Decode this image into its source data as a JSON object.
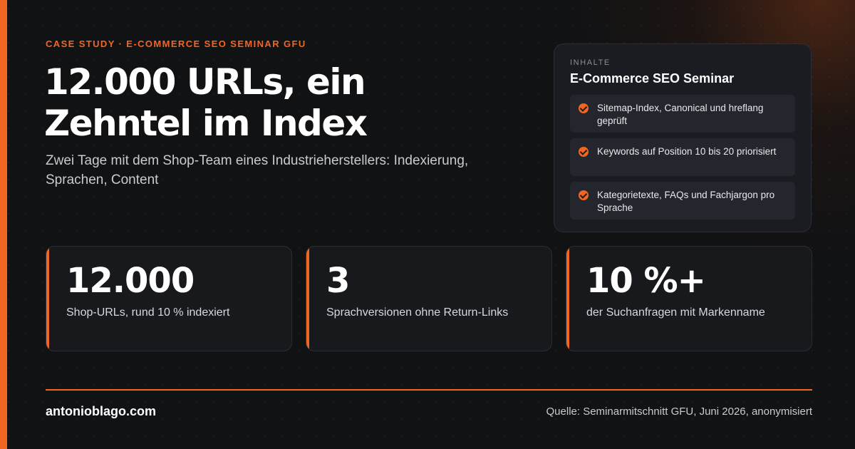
{
  "eyebrow": "CASE STUDY · E-COMMERCE SEO SEMINAR GFU",
  "headline": "12.000 URLs, ein Zehntel im Index",
  "subline": "Zwei Tage mit dem Shop-Team eines Industrieherstellers: Indexierung, Sprachen, Content",
  "content_card": {
    "kicker": "INHALTE",
    "title": "E-Commerce SEO Seminar",
    "items": [
      {
        "icon": "check-circle-icon",
        "text": "Sitemap-Index, Canonical und hreflang geprüft"
      },
      {
        "icon": "check-circle-icon",
        "text": "Keywords auf Position 10 bis 20 priorisiert"
      },
      {
        "icon": "check-circle-icon",
        "text": "Kategorietexte, FAQs und Fachjargon pro Sprache"
      }
    ]
  },
  "stats": [
    {
      "value": "12.000",
      "label": "Shop-URLs, rund 10 % indexiert"
    },
    {
      "value": "3",
      "label": "Sprachversionen ohne Return-Links"
    },
    {
      "value": "10 %+",
      "label": "der Suchanfragen mit Markenname"
    }
  ],
  "footer": {
    "domain": "antonioblago.com",
    "source": "Quelle: Seminarmitschnitt GFU, Juni 2026, anonymisiert"
  },
  "colors": {
    "accent": "#f26522",
    "background": "#111214",
    "card": "#1a1c21"
  }
}
